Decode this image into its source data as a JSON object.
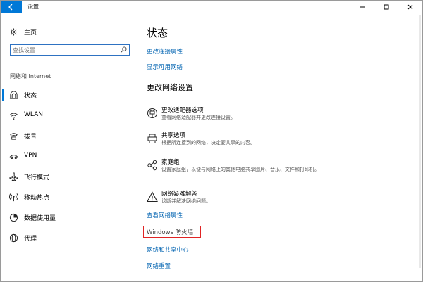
{
  "titlebar": {
    "title": "设置"
  },
  "sidebar": {
    "home_label": "主页",
    "search_placeholder": "查找设置",
    "section_label": "网络和 Internet",
    "items": [
      {
        "label": "状态",
        "icon": "status-icon"
      },
      {
        "label": "WLAN",
        "icon": "wifi-icon"
      },
      {
        "label": "拨号",
        "icon": "dialup-icon"
      },
      {
        "label": "VPN",
        "icon": "vpn-icon"
      },
      {
        "label": "飞行模式",
        "icon": "airplane-icon"
      },
      {
        "label": "移动热点",
        "icon": "hotspot-icon"
      },
      {
        "label": "数据使用量",
        "icon": "data-usage-icon"
      },
      {
        "label": "代理",
        "icon": "proxy-icon"
      }
    ]
  },
  "main": {
    "title": "状态",
    "links_top": [
      "更改连接属性",
      "显示可用网络"
    ],
    "section_title": "更改网络设置",
    "options": [
      {
        "title": "更改适配器选项",
        "desc": "查看网络适配器并更改连接设置。",
        "icon": "adapter-icon"
      },
      {
        "title": "共享选项",
        "desc": "根据所连接到的网络，决定要共享的内容。",
        "icon": "sharing-icon"
      },
      {
        "title": "家庭组",
        "desc": "设置家庭组，以便与网络上的其他电脑共享图片、音乐、文件和打印机。",
        "icon": "homegroup-icon"
      },
      {
        "title": "网络疑难解答",
        "desc": "诊断并解决网络问题。",
        "icon": "troubleshoot-icon"
      }
    ],
    "links_bottom": {
      "view_properties": "查看网络属性",
      "firewall": "Windows 防火墙",
      "sharing_center": "网络和共享中心",
      "reset": "网络重置"
    }
  },
  "colors": {
    "accent": "#0078d7",
    "link": "#0063b1",
    "highlight_box": "#e02424"
  }
}
